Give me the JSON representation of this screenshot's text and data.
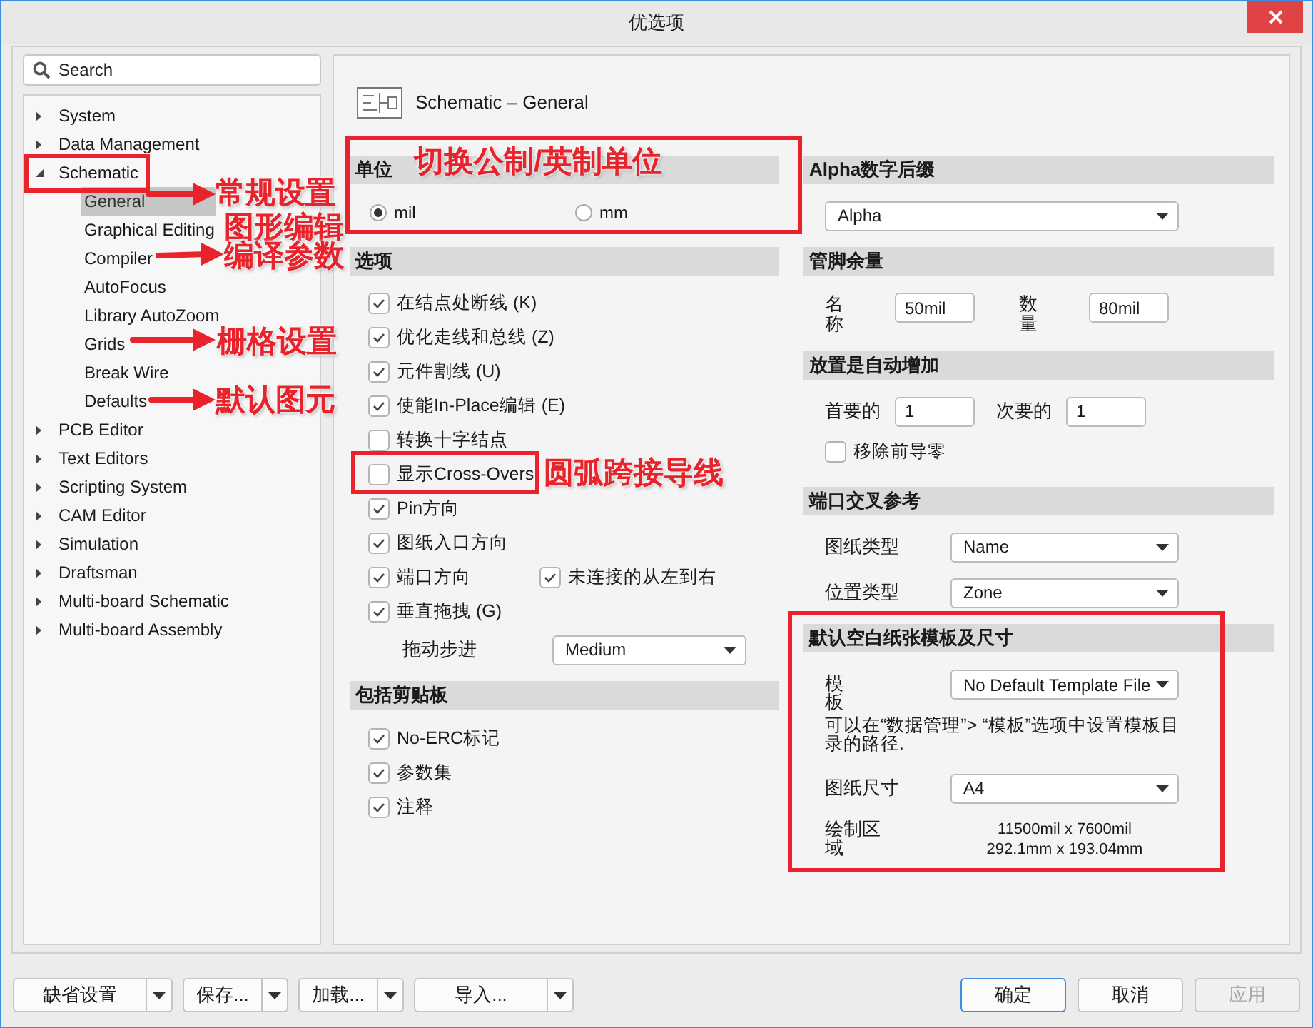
{
  "window": {
    "title": "优选项"
  },
  "search": {
    "placeholder": "Search"
  },
  "tree": [
    {
      "label": "System",
      "expanded": false,
      "selected": false
    },
    {
      "label": "Data Management",
      "expanded": false,
      "selected": false
    },
    {
      "label": "Schematic",
      "expanded": true,
      "selected": false,
      "children": [
        {
          "label": "General",
          "selected": true
        },
        {
          "label": "Graphical Editing",
          "selected": false
        },
        {
          "label": "Compiler",
          "selected": false
        },
        {
          "label": "AutoFocus",
          "selected": false
        },
        {
          "label": "Library AutoZoom",
          "selected": false
        },
        {
          "label": "Grids",
          "selected": false
        },
        {
          "label": "Break Wire",
          "selected": false
        },
        {
          "label": "Defaults",
          "selected": false
        }
      ]
    },
    {
      "label": "PCB Editor",
      "expanded": false,
      "selected": false
    },
    {
      "label": "Text Editors",
      "expanded": false,
      "selected": false
    },
    {
      "label": "Scripting System",
      "expanded": false,
      "selected": false
    },
    {
      "label": "CAM Editor",
      "expanded": false,
      "selected": false
    },
    {
      "label": "Simulation",
      "expanded": false,
      "selected": false
    },
    {
      "label": "Draftsman",
      "expanded": false,
      "selected": false
    },
    {
      "label": "Multi-board Schematic",
      "expanded": false,
      "selected": false
    },
    {
      "label": "Multi-board Assembly",
      "expanded": false,
      "selected": false
    }
  ],
  "page": {
    "title": "Schematic – General"
  },
  "units": {
    "title": "单位",
    "options": [
      {
        "label": "mil",
        "selected": true
      },
      {
        "label": "mm",
        "selected": false
      }
    ]
  },
  "options": {
    "title": "选项",
    "items": [
      {
        "label": "在结点处断线 (K)",
        "checked": true
      },
      {
        "label": "优化走线和总线 (Z)",
        "checked": true
      },
      {
        "label": "元件割线 (U)",
        "checked": true
      },
      {
        "label": "使能In-Place编辑 (E)",
        "checked": true
      },
      {
        "label": "转换十字结点",
        "checked": false
      },
      {
        "label": "显示Cross-Overs",
        "checked": false
      },
      {
        "label": "Pin方向",
        "checked": true
      },
      {
        "label": "图纸入口方向",
        "checked": true
      },
      {
        "label": "端口方向",
        "checked": true,
        "extra": {
          "label": "未连接的从左到右",
          "checked": true
        }
      },
      {
        "label": "垂直拖拽 (G)",
        "checked": true
      }
    ]
  },
  "drag_step": {
    "label": "拖动步进",
    "value": "Medium"
  },
  "clipboard": {
    "title": "包括剪贴板",
    "items": [
      {
        "label": "No-ERC标记",
        "checked": true
      },
      {
        "label": "参数集",
        "checked": true
      },
      {
        "label": "注释",
        "checked": true
      }
    ]
  },
  "alpha": {
    "title": "Alpha数字后缀",
    "value": "Alpha"
  },
  "pin_margin": {
    "title": "管脚余量",
    "fields": [
      {
        "label": "名称",
        "value": "50mil"
      },
      {
        "label": "数量",
        "value": "80mil"
      }
    ]
  },
  "auto_increment": {
    "title": "放置是自动增加",
    "fields": [
      {
        "label": "首要的",
        "value": "1"
      },
      {
        "label": "次要的",
        "value": "1"
      }
    ],
    "remove_leading_zeros": {
      "label": "移除前导零",
      "checked": false
    }
  },
  "port_cross_ref": {
    "title": "端口交叉参考",
    "rows": [
      {
        "label": "图纸类型",
        "value": "Name"
      },
      {
        "label": "位置类型",
        "value": "Zone"
      }
    ]
  },
  "sheet": {
    "title": "默认空白纸张模板及尺寸",
    "template": {
      "label": "模板",
      "value": "No Default Template File"
    },
    "hint": "可以在“数据管理”> “模板”选项中设置模板目录的路径.",
    "size": {
      "label": "图纸尺寸",
      "value": "A4"
    },
    "area": {
      "label": "绘制区域",
      "values": [
        "11500mil x 7600mil",
        "292.1mm x 193.04mm"
      ]
    }
  },
  "footer": {
    "left": [
      {
        "label": "缺省设置"
      },
      {
        "label": "保存..."
      },
      {
        "label": "加载..."
      },
      {
        "label": "导入..."
      }
    ],
    "right": [
      {
        "label": "确定",
        "default": true,
        "disabled": false
      },
      {
        "label": "取消",
        "default": false,
        "disabled": false
      },
      {
        "label": "应用",
        "default": false,
        "disabled": true
      }
    ]
  },
  "annotations": [
    "常规设置",
    "图形编辑",
    "编译参数",
    "栅格设置",
    "默认图元",
    "切换公制/英制单位",
    "圆弧跨接导线"
  ]
}
